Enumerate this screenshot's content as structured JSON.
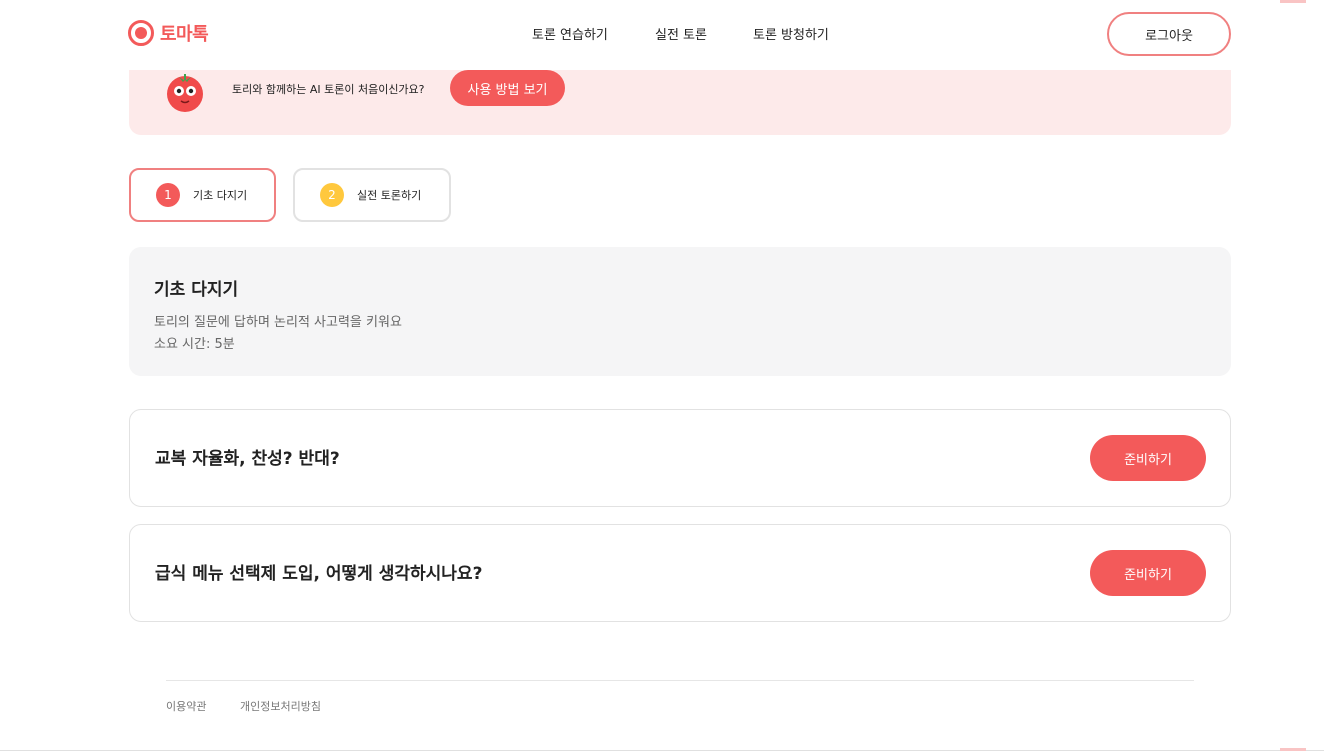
{
  "header": {
    "logo_text": "토마톡",
    "nav": [
      "토론 연습하기",
      "실전 토론",
      "토론 방청하기"
    ],
    "logout_label": "로그아웃"
  },
  "banner": {
    "text": "토리와 함께하는 AI 토론이 처음이신가요?",
    "button_label": "사용 방법 보기"
  },
  "steps": [
    {
      "number": "1",
      "label": "기초 다지기",
      "active": true
    },
    {
      "number": "2",
      "label": "실전 토론하기",
      "active": false
    }
  ],
  "info": {
    "title": "기초 다지기",
    "description": "토리의 질문에 답하며 논리적 사고력을 키워요",
    "time": "소요 시간: 5분"
  },
  "topics": [
    {
      "title": "교복 자율화, 찬성? 반대?",
      "button_label": "준비하기"
    },
    {
      "title": "급식 메뉴 선택제 도입, 어떻게 생각하시나요?",
      "button_label": "준비하기"
    }
  ],
  "footer": {
    "links": [
      "이용약관",
      "개인정보처리방침"
    ]
  },
  "colors": {
    "accent": "#f35a5a",
    "banner_bg": "#fdeaea",
    "step2": "#ffc83d",
    "card_bg": "#f5f5f6"
  }
}
